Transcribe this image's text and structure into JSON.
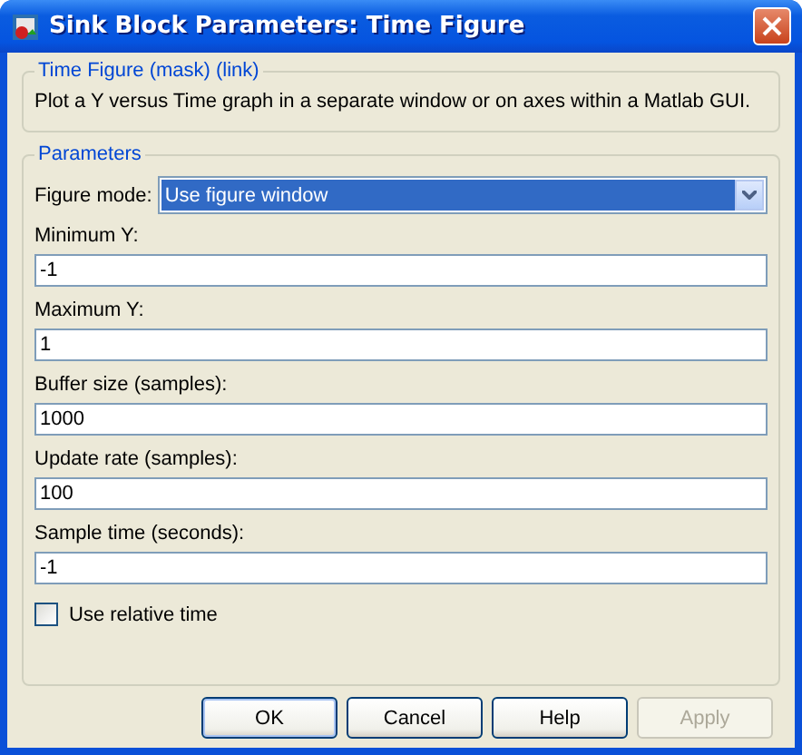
{
  "window": {
    "title": "Sink Block Parameters: Time Figure"
  },
  "mask": {
    "title": "Time Figure (mask) (link)",
    "description": "Plot a Y versus Time graph in a separate window or on axes within a Matlab GUI."
  },
  "parameters": {
    "title": "Parameters",
    "fields": [
      {
        "kind": "select",
        "label": "Figure mode:",
        "value": "Use figure window"
      },
      {
        "kind": "text",
        "label": "Minimum Y:",
        "value": "-1"
      },
      {
        "kind": "text",
        "label": "Maximum Y:",
        "value": "1"
      },
      {
        "kind": "text",
        "label": "Buffer size (samples):",
        "value": "1000"
      },
      {
        "kind": "text",
        "label": "Update rate (samples):",
        "value": "100"
      },
      {
        "kind": "text",
        "label": "Sample time (seconds):",
        "value": "-1"
      },
      {
        "kind": "checkbox",
        "label": "Use relative time",
        "checked": false
      }
    ]
  },
  "buttons": [
    {
      "label": "OK",
      "default": true,
      "disabled": false
    },
    {
      "label": "Cancel",
      "default": false,
      "disabled": false
    },
    {
      "label": "Help",
      "default": false,
      "disabled": false
    },
    {
      "label": "Apply",
      "default": false,
      "disabled": true
    }
  ]
}
